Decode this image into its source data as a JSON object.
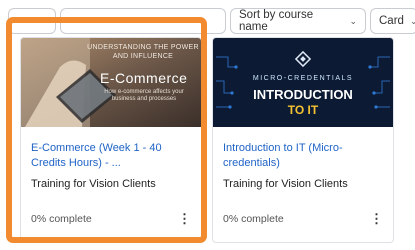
{
  "toolbar": {
    "sort_label": "Sort by course name",
    "view_label": "Card"
  },
  "courses": [
    {
      "banner": {
        "kicker": "UNDERSTANDING THE POWER AND INFLUENCE",
        "heading": "E-Commerce",
        "caption": "How e-commerce affects your business and processes"
      },
      "title": "E-Commerce (Week 1 - 40 Credits Hours) - ...",
      "subtitle": "Training for Vision Clients",
      "progress": "0% complete",
      "menu_glyph": "⋮"
    },
    {
      "banner": {
        "kicker": "MICRO-CREDENTIALS",
        "heading": "INTRODUCTION",
        "heading2": "TO IT"
      },
      "title": "Introduction to IT (Micro-credentials)",
      "subtitle": "Training for Vision Clients",
      "progress": "0% complete",
      "menu_glyph": "⋮"
    }
  ],
  "colors": {
    "highlight": "#f28a2f",
    "link": "#1f63c6",
    "banner2_bg": "#0c1a33"
  }
}
